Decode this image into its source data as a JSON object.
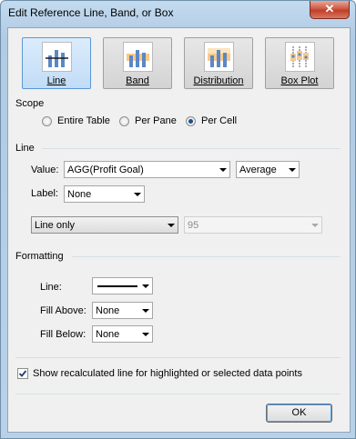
{
  "window": {
    "title": "Edit Reference Line, Band, or Box",
    "close_label": "✕"
  },
  "types": [
    {
      "label": "Line",
      "active": true
    },
    {
      "label": "Band",
      "active": false
    },
    {
      "label": "Distribution",
      "active": false
    },
    {
      "label": "Box Plot",
      "active": false
    }
  ],
  "scope": {
    "heading": "Scope",
    "options": [
      {
        "label": "Entire Table",
        "selected": false
      },
      {
        "label": "Per Pane",
        "selected": false
      },
      {
        "label": "Per Cell",
        "selected": true
      }
    ]
  },
  "line": {
    "heading": "Line",
    "value_label": "Value:",
    "value": "AGG(Profit Goal)",
    "aggregation": "Average",
    "label_label": "Label:",
    "label_value": "None",
    "style": "Line only",
    "confidence": "95"
  },
  "formatting": {
    "heading": "Formatting",
    "line_label": "Line:",
    "fill_above_label": "Fill Above:",
    "fill_above": "None",
    "fill_below_label": "Fill Below:",
    "fill_below": "None"
  },
  "recalc": {
    "label": "Show recalculated line for highlighted or selected data points",
    "checked": true
  },
  "ok_label": "OK"
}
